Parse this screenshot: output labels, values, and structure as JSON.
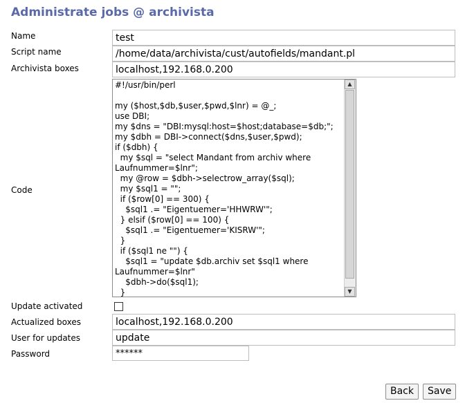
{
  "page": {
    "title": "Administrate jobs @ archivista"
  },
  "form": {
    "name_label": "Name",
    "name_value": "test",
    "script_label": "Script name",
    "script_value": "/home/data/archivista/cust/autofields/mandant.pl",
    "boxes_label": "Archivista boxes",
    "boxes_value": "localhost,192.168.0.200",
    "code_label": "Code",
    "code_lines": [
      "#!/usr/bin/perl",
      "",
      "my ($host,$db,$user,$pwd,$lnr) = @_;",
      "use DBI;",
      "my $dns = \"DBI:mysql:host=$host;database=$db;\";",
      "my $dbh = DBI->connect($dns,$user,$pwd);",
      "if ($dbh) {",
      "  my $sql = \"select Mandant from archiv where",
      "Laufnummer=$lnr\";",
      "  my @row = $dbh->selectrow_array($sql);",
      "  my $sql1 = \"\";",
      "  if ($row[0] == 300) {",
      "    $sql1 .= \"Eigentuemer='HHWRW'\";",
      "  } elsif ($row[0] == 100) {",
      "    $sql1 .= \"Eigentuemer='KISRW'\";",
      "  }",
      "  if ($sql1 ne \"\") {",
      "    $sql1 = \"update $db.archiv set $sql1 where",
      "Laufnummer=$lnr\"",
      "    $dbh->do($sql1);",
      "  }"
    ],
    "update_label": "Update activated",
    "actualized_label": "Actualized boxes",
    "actualized_value": "localhost,192.168.0.200",
    "user_label": "User for updates",
    "user_value": "update",
    "password_label": "Password",
    "password_value": "******"
  },
  "buttons": {
    "back": "Back",
    "save": "Save"
  },
  "scrollbar": {
    "up_icon": "▲",
    "down_icon": "▼"
  }
}
